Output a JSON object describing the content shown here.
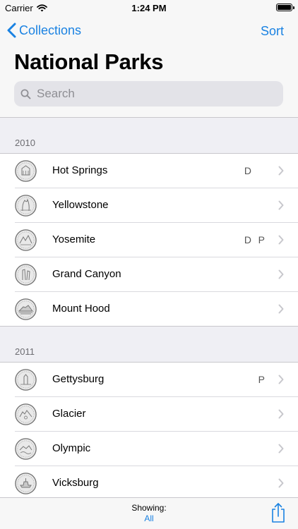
{
  "status_bar": {
    "carrier": "Carrier",
    "time": "1:24 PM"
  },
  "nav": {
    "back_label": "Collections",
    "sort_label": "Sort",
    "title": "National Parks"
  },
  "search": {
    "placeholder": "Search"
  },
  "sections": [
    {
      "year": "2010",
      "items": [
        {
          "name": "Hot Springs",
          "mint_d": "D",
          "mint_p": ""
        },
        {
          "name": "Yellowstone",
          "mint_d": "",
          "mint_p": ""
        },
        {
          "name": "Yosemite",
          "mint_d": "D",
          "mint_p": "P"
        },
        {
          "name": "Grand Canyon",
          "mint_d": "",
          "mint_p": ""
        },
        {
          "name": "Mount Hood",
          "mint_d": "",
          "mint_p": ""
        }
      ]
    },
    {
      "year": "2011",
      "items": [
        {
          "name": "Gettysburg",
          "mint_d": "",
          "mint_p": "P"
        },
        {
          "name": "Glacier",
          "mint_d": "",
          "mint_p": ""
        },
        {
          "name": "Olympic",
          "mint_d": "",
          "mint_p": ""
        },
        {
          "name": "Vicksburg",
          "mint_d": "",
          "mint_p": ""
        }
      ]
    }
  ],
  "toolbar": {
    "showing_label": "Showing:",
    "showing_value": "All"
  },
  "colors": {
    "accent": "#1a82e2",
    "background": "#efeff4"
  },
  "icons": {
    "wifi": "wifi-icon",
    "battery": "battery-icon",
    "back": "chevron-left-icon",
    "search": "search-icon",
    "row": "chevron-right-icon",
    "share": "share-icon",
    "coin": "coin-thumbnail"
  }
}
